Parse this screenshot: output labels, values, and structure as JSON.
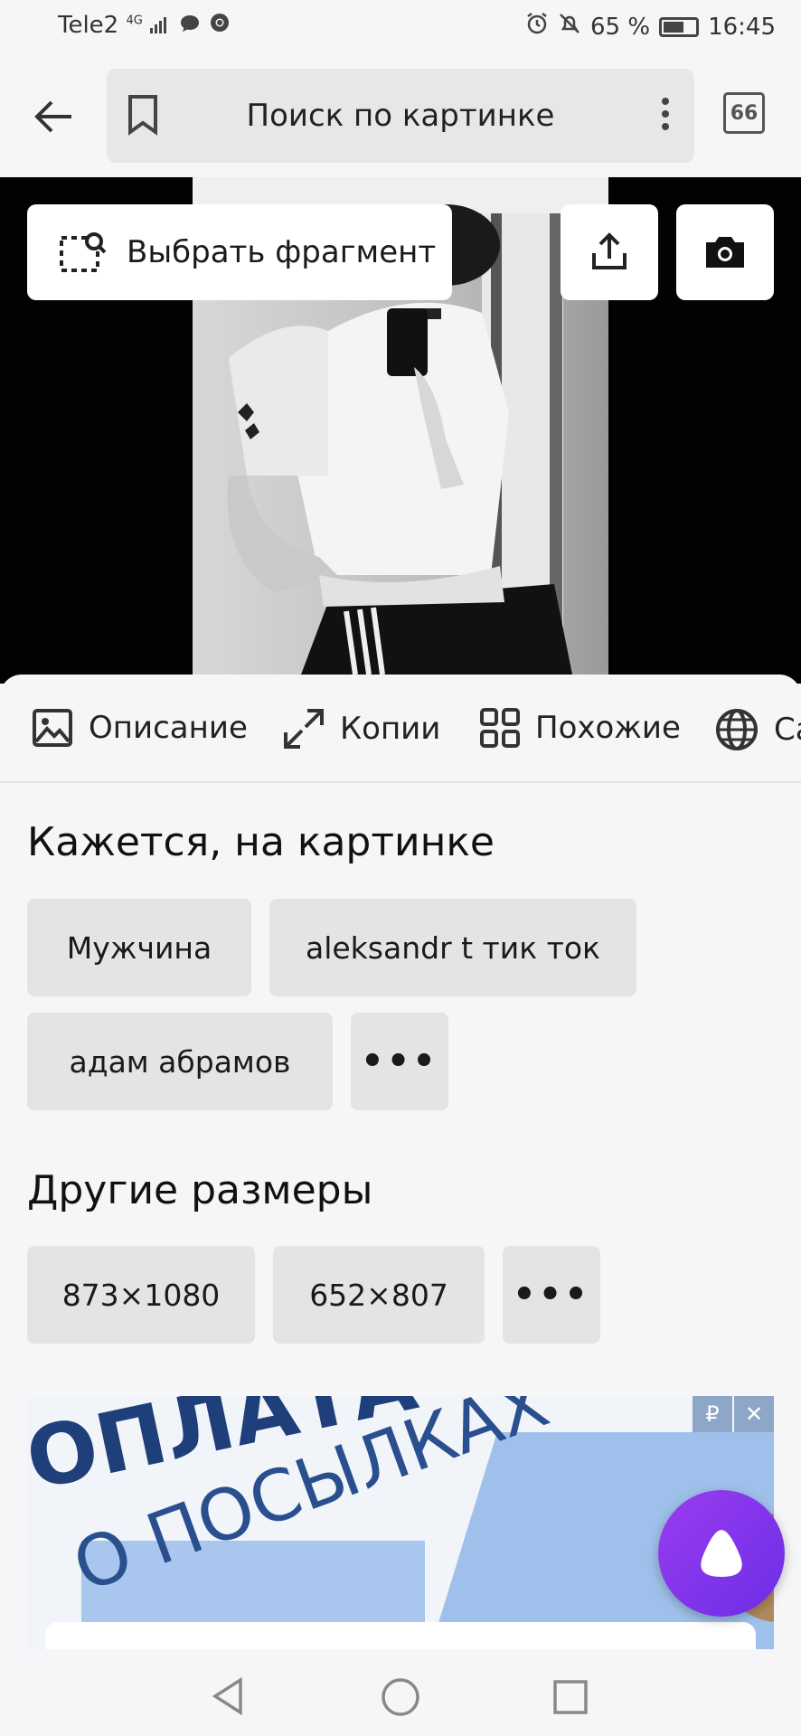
{
  "status_bar": {
    "carrier": "Tele2",
    "network": "4G",
    "battery_percent": "65 %",
    "battery_level": 0.65,
    "time": "16:45"
  },
  "header": {
    "title": "Поиск по картинке",
    "tabs_count": "66"
  },
  "image_toolbar": {
    "fragment_label": "Выбрать фрагмент"
  },
  "nav_tabs": [
    {
      "label": "Описание",
      "icon": "image-icon"
    },
    {
      "label": "Копии",
      "icon": "expand-arrows-icon"
    },
    {
      "label": "Похожие",
      "icon": "grid-icon"
    },
    {
      "label": "Сайты",
      "icon": "globe-icon"
    }
  ],
  "recognized": {
    "title": "Кажется, на картинке",
    "tags": [
      "Мужчина",
      "aleksandr t тик ток",
      "адам абрамов"
    ],
    "more": "•••"
  },
  "sizes": {
    "title": "Другие размеры",
    "items": [
      "873×1080",
      "652×807"
    ],
    "more": "•••"
  },
  "ad": {
    "currency_badge": "₽",
    "close_badge": "✕",
    "text_line1": "ОПЛАТА",
    "text_line2": "О ПОСЫЛКАХ"
  },
  "colors": {
    "background": "#f6f6f8",
    "chip": "#e4e4e7",
    "alice_purple": "#8a3ef0"
  }
}
